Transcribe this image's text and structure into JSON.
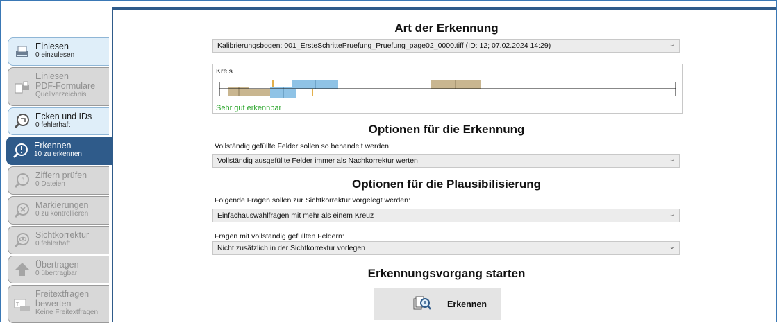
{
  "sidebar": {
    "items": [
      {
        "title": "Einlesen",
        "sub": "0 einzulesen",
        "icon": "scanner-icon"
      },
      {
        "title": "Einlesen",
        "title2": "PDF-Formulare",
        "sub": "Quellverzeichnis",
        "icon": "pdf-forms-icon"
      },
      {
        "title": "Ecken und IDs",
        "sub": "0 fehlerhaft",
        "icon": "corner-search-icon"
      },
      {
        "title": "Erkennen",
        "sub": "10 zu erkennen",
        "icon": "recognize-icon"
      },
      {
        "title": "Ziffern prüfen",
        "sub": "0 Dateien",
        "icon": "digit-check-icon"
      },
      {
        "title": "Markierungen",
        "sub": "0 zu kontrollieren",
        "icon": "marking-check-icon"
      },
      {
        "title": "Sichtkorrektur",
        "sub": "0 fehlerhaft",
        "icon": "visual-correction-icon"
      },
      {
        "title": "Übertragen",
        "sub": "0 übertragbar",
        "icon": "transfer-up-icon"
      },
      {
        "title": "Freitextfragen",
        "title2": "bewerten",
        "sub": "Keine Freitextfragen",
        "icon": "freetext-icon"
      }
    ]
  },
  "main": {
    "heading_art": "Art der Erkennung",
    "calibration_select": "Kalibrierungsbogen: 001_ErsteSchrittePruefung_Pruefung_page02_0000.tiff (ID: 12; 07.02.2024 14:29)",
    "kreis_label": "Kreis",
    "kreis_status": "Sehr gut erkennbar",
    "kreis_status_color": "#2aa52a",
    "heading_options": "Optionen für die Erkennung",
    "filled_label": "Vollständig gefüllte Felder sollen so behandelt werden:",
    "filled_select": "Vollständig ausgefüllte Felder immer als Nachkorrektur werten",
    "heading_plaus": "Optionen für die Plausibilisierung",
    "questions_label": "Folgende Fragen sollen zur Sichtkorrektur vorgelegt werden:",
    "questions_select": "Einfachauswahlfragen mit mehr als einem Kreuz",
    "full_fields_label": "Fragen mit vollständig gefüllten Feldern:",
    "full_fields_select": "Nicht zusätzlich in der Sichtkorrektur vorlegen",
    "heading_start": "Erkennungsvorgang starten",
    "start_button": "Erkennen"
  },
  "colors": {
    "accent": "#2f5b8a",
    "brown": "#c9b690",
    "blue": "#8fc3e6",
    "orange": "#e3b04c"
  }
}
